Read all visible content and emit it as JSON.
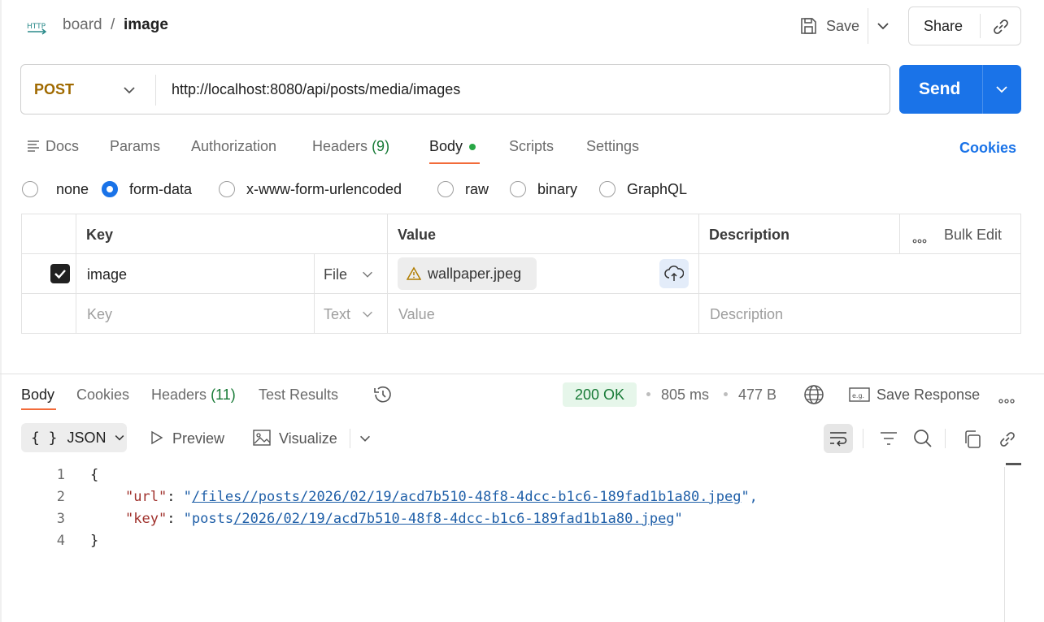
{
  "header": {
    "app_icon_label": "HTTP",
    "breadcrumb_parent": "board",
    "breadcrumb_sep": "/",
    "breadcrumb_current": "image",
    "save_label": "Save",
    "share_label": "Share"
  },
  "request": {
    "method": "POST",
    "url": "http://localhost:8080/api/posts/media/images",
    "send_label": "Send"
  },
  "tabs": [
    {
      "label": "Docs"
    },
    {
      "label": "Params"
    },
    {
      "label": "Authorization"
    },
    {
      "label": "Headers",
      "count": "(9)"
    },
    {
      "label": "Body",
      "active": true
    },
    {
      "label": "Scripts"
    },
    {
      "label": "Settings"
    }
  ],
  "cookies_link": "Cookies",
  "body_types": [
    {
      "label": "none",
      "selected": false
    },
    {
      "label": "form-data",
      "selected": true
    },
    {
      "label": "x-www-form-urlencoded",
      "selected": false
    },
    {
      "label": "raw",
      "selected": false
    },
    {
      "label": "binary",
      "selected": false
    },
    {
      "label": "GraphQL",
      "selected": false
    }
  ],
  "table": {
    "columns": {
      "key": "Key",
      "value": "Value",
      "description": "Description"
    },
    "bulk_edit": "Bulk Edit",
    "rows": [
      {
        "checked": true,
        "key": "image",
        "type": "File",
        "value": "wallpaper.jpeg",
        "description": ""
      }
    ],
    "placeholder": {
      "key": "Key",
      "type": "Text",
      "value": "Value",
      "description": "Description"
    }
  },
  "response": {
    "tabs": [
      {
        "label": "Body",
        "active": true
      },
      {
        "label": "Cookies"
      },
      {
        "label": "Headers",
        "count": "(11)"
      },
      {
        "label": "Test Results"
      }
    ],
    "status": "200 OK",
    "time": "805 ms",
    "size": "477 B",
    "save_response": "Save Response",
    "format": "JSON",
    "preview": "Preview",
    "visualize": "Visualize",
    "lines": [
      {
        "n": "1",
        "text": "{"
      },
      {
        "n": "2",
        "key": "\"url\"",
        "value_prefix": "\"",
        "value_link": "/files//posts/2026/02/19/acd7b510-48f8-4dcc-b1c6-189fad1b1a80.jpeg",
        "value_suffix": "\","
      },
      {
        "n": "3",
        "key": "\"key\"",
        "value_prefix": "\"posts",
        "value_link": "/2026/02/19/acd7b510-48f8-4dcc-b1c6-189fad1b1a80.jpeg",
        "value_suffix": "\""
      },
      {
        "n": "4",
        "text": "}"
      }
    ]
  }
}
